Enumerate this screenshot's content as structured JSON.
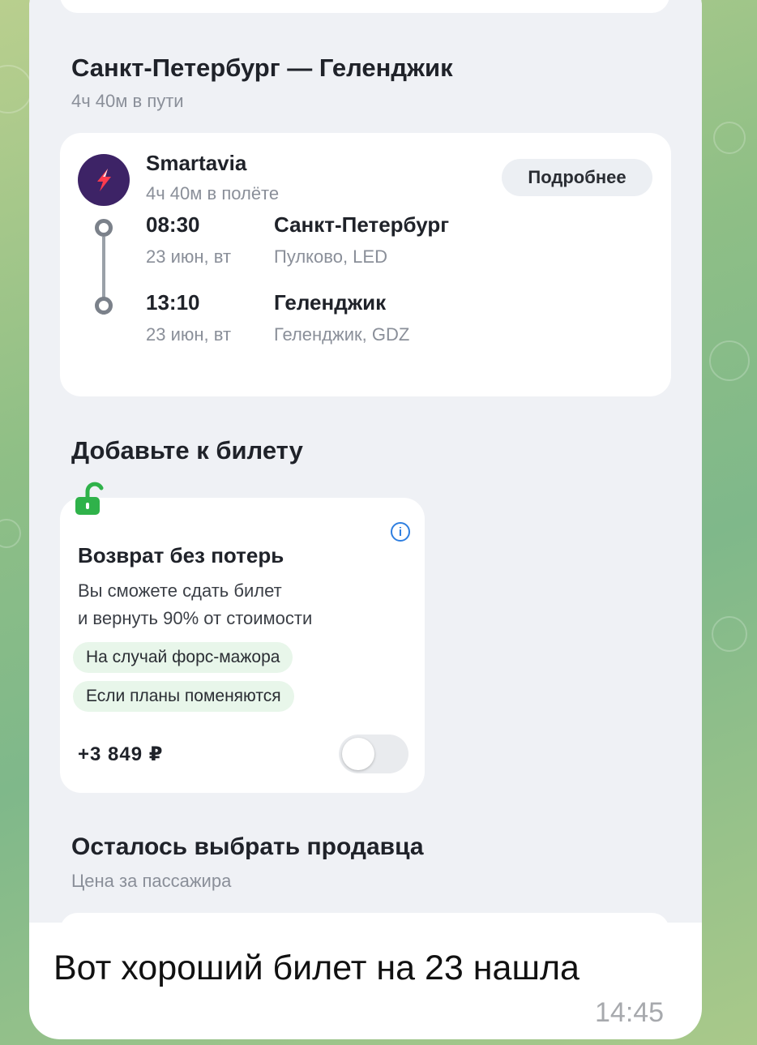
{
  "header": {
    "route_title": "Санкт-Петербург — Геленджик",
    "travel_time": "4ч 40м в пути"
  },
  "flight": {
    "airline": "Smartavia",
    "flight_time": "4ч 40м в полёте",
    "details_label": "Подробнее",
    "departure": {
      "time": "08:30",
      "date": "23 июн, вт",
      "city": "Санкт-Петербург",
      "airport": "Пулково, LED"
    },
    "arrival": {
      "time": "13:10",
      "date": "23 июн, вт",
      "city": "Геленджик",
      "airport": "Геленджик, GDZ"
    }
  },
  "addons": {
    "section_title": "Добавьте к билету",
    "card": {
      "title": "Возврат без потерь",
      "description_line1": "Вы сможете сдать билет",
      "description_line2": "и вернуть 90% от стоимости",
      "tags": [
        "На случай форс-мажора",
        "Если планы поменяются"
      ],
      "price": "+3 849 ₽",
      "toggle_on": false
    }
  },
  "seller": {
    "title": "Осталось выбрать продавца",
    "subtitle": "Цена за пассажира"
  },
  "message": {
    "text": "Вот хороший билет на 23 нашла",
    "time": "14:45"
  },
  "colors": {
    "airline_logo_bg": "#3d2366",
    "lock_icon": "#2fb24a",
    "info_icon": "#2f7fe0",
    "tag_bg": "#e8f6ea"
  }
}
